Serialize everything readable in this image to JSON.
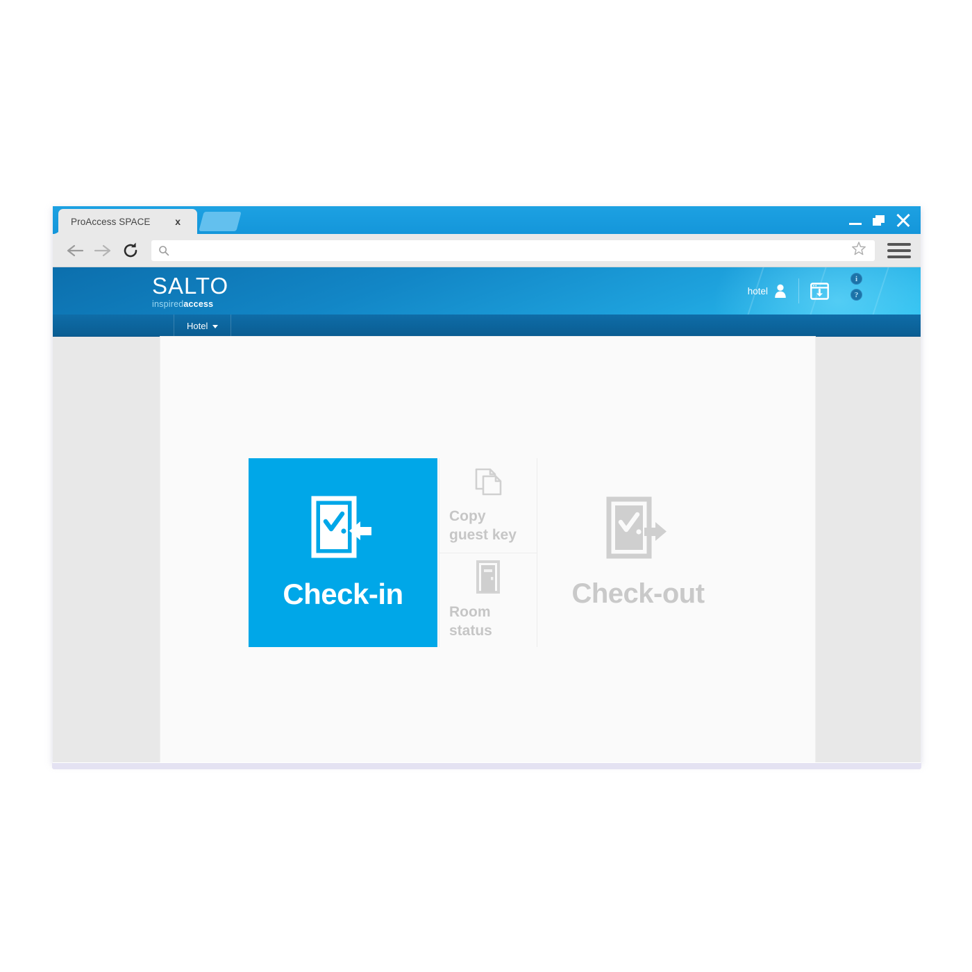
{
  "browser": {
    "tab": {
      "title": "ProAccess SPACE",
      "close_label": "x"
    },
    "newtab_icon": "new-tab-icon",
    "window_controls": {
      "minimize": "minimize-icon",
      "maximize": "restore-icon",
      "close": "close-icon"
    },
    "toolbar": {
      "back_icon": "back-arrow-icon",
      "forward_icon": "forward-arrow-icon",
      "reload_icon": "reload-icon",
      "search_icon": "search-icon",
      "url_value": "",
      "url_placeholder": "",
      "bookmark_icon": "star-icon",
      "menu_icon": "hamburger-menu-icon"
    }
  },
  "app": {
    "logo": {
      "main": "SALTO",
      "sub_light": "inspired",
      "sub_bold": "access"
    },
    "header": {
      "user_label": "hotel",
      "user_icon": "user-avatar-icon",
      "download_icon": "browser-download-icon",
      "info_icon": "i",
      "help_icon": "?"
    },
    "nav": {
      "items": [
        {
          "label": "Hotel",
          "chevron": "chevron-down-icon"
        }
      ]
    },
    "tiles": {
      "check_in": {
        "label": "Check-in",
        "icon": "door-check-in-icon"
      },
      "copy_guest_key": {
        "label": "Copy guest key",
        "icon": "copy-documents-icon"
      },
      "room_status": {
        "label": "Room status",
        "icon": "door-icon"
      },
      "check_out": {
        "label": "Check-out",
        "icon": "door-check-out-icon"
      }
    }
  },
  "colors": {
    "brand_cyan": "#00a7e8",
    "header_blue_dark": "#0c6fad",
    "header_blue_light": "#2bc0f0",
    "nav_blue": "#0a5d92",
    "tab_blue": "#1da1e2",
    "muted_gray": "#c6c6c6",
    "panel_bg": "#fafafa",
    "app_bg": "#e8e8e8"
  }
}
